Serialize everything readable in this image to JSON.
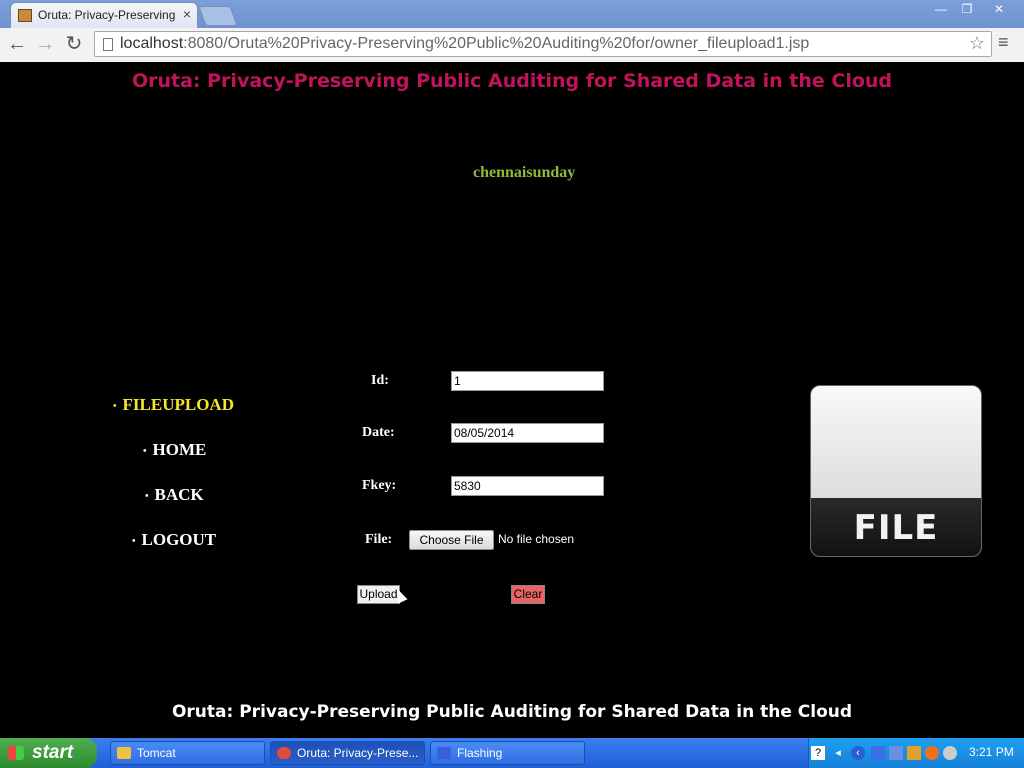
{
  "browser": {
    "tab_title": "Oruta: Privacy-Preserving Pu",
    "tab_close": "×",
    "window_buttons": [
      "—",
      "❐",
      "✕"
    ],
    "back": "←",
    "forward": "→",
    "reload": "↻",
    "url_host": "localhost",
    "url_path": ":8080/Oruta%20Privacy-Preserving%20Public%20Auditing%20for/owner_fileupload1.jsp",
    "star": "☆",
    "menu": "≡"
  },
  "page": {
    "header_title": "Oruta: Privacy-Preserving Public Auditing for Shared Data in the Cloud",
    "username": "chennaisunday",
    "nav": [
      {
        "label": "FILEUPLOAD",
        "active": true
      },
      {
        "label": "HOME",
        "active": false
      },
      {
        "label": "BACK",
        "active": false
      },
      {
        "label": "LOGOUT",
        "active": false
      }
    ],
    "bullet": "•",
    "form": {
      "id_label": "Id:",
      "id_value": "1",
      "date_label": "Date:",
      "date_value": "08/05/2014",
      "fkey_label": "Fkey:",
      "fkey_value": "5830",
      "file_label": "File:",
      "choose_file": "Choose File",
      "no_file": "No file chosen",
      "upload": "Upload",
      "clear": "Clear"
    },
    "file_image_text": "FILE",
    "footer_title": "Oruta: Privacy-Preserving Public Auditing for Shared Data in the Cloud"
  },
  "taskbar": {
    "start": "start",
    "tasks": [
      {
        "label": "Tomcat",
        "active": false,
        "color": "#f0c040"
      },
      {
        "label": "Oruta: Privacy-Prese...",
        "active": true,
        "color": "#e04b3a"
      },
      {
        "label": "Flashing",
        "active": false,
        "color": "#3a5fe0"
      }
    ],
    "clock": "3:21 PM"
  },
  "colors": {
    "header": "#c0145a",
    "username": "#8cbc3c",
    "active_nav": "#f5e82a",
    "clear_button": "#e86565"
  }
}
